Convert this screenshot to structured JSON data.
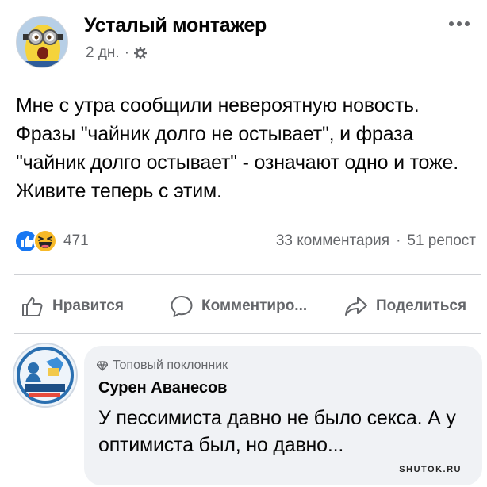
{
  "post": {
    "author": "Усталый монтажер",
    "time": "2 дн.",
    "separator": "·",
    "text": "Мне с утра сообщили невероятную новость. Фразы \"чайник долго не остывает\", и фраза \"чайник долго остывает\" - означают одно и тоже. Живите теперь с этим."
  },
  "reactions": {
    "count": "471",
    "comments": "33 комментария",
    "dot": "·",
    "shares": "51 репост"
  },
  "actions": {
    "like": "Нравится",
    "comment": "Комментиро...",
    "share": "Поделиться"
  },
  "comment": {
    "badge": "Топовый поклонник",
    "author": "Сурен Аванесов",
    "text": "У пессимиста давно не было секса. А у оптимиста был, но давно..."
  },
  "watermark": "SHUTOK.RU",
  "icons": {
    "more": "more-options-icon",
    "privacy": "gear-icon",
    "like_reaction": "like-reaction-icon",
    "haha_reaction": "haha-reaction-icon",
    "like_action": "thumbs-up-icon",
    "comment_action": "speech-bubble-icon",
    "share_action": "share-arrow-icon",
    "badge": "diamond-badge-icon"
  },
  "colors": {
    "like_blue": "#1877f2",
    "haha_yellow": "#f7b928",
    "meta_gray": "#65676b",
    "bubble_bg": "#f0f2f5"
  }
}
